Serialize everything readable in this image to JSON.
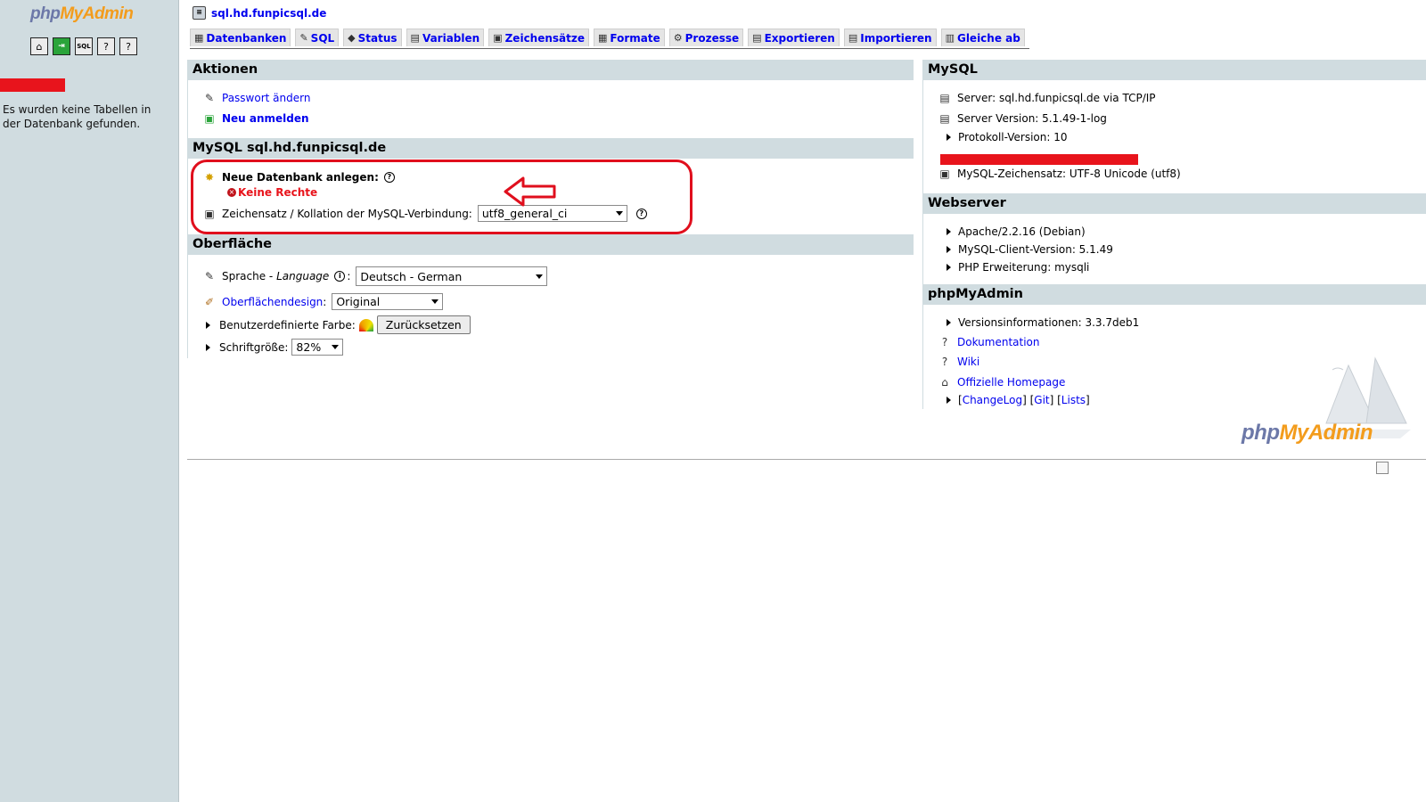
{
  "left": {
    "logo": {
      "php": "php",
      "my": "My",
      "admin": "Admin"
    },
    "icons": [
      "home-icon",
      "exit-icon",
      "sql-icon",
      "docs-icon",
      "docs2-icon"
    ],
    "message": "Es wurden keine Tabellen in der Datenbank gefunden."
  },
  "header": {
    "server": "sql.hd.funpicsql.de"
  },
  "tabs": [
    {
      "label": "Datenbanken",
      "icon": "db-icon"
    },
    {
      "label": "SQL",
      "icon": "sql-icon"
    },
    {
      "label": "Status",
      "icon": "status-icon"
    },
    {
      "label": "Variablen",
      "icon": "variables-icon"
    },
    {
      "label": "Zeichensätze",
      "icon": "charset-icon"
    },
    {
      "label": "Formate",
      "icon": "engines-icon"
    },
    {
      "label": "Prozesse",
      "icon": "processes-icon"
    },
    {
      "label": "Exportieren",
      "icon": "export-icon"
    },
    {
      "label": "Importieren",
      "icon": "import-icon"
    },
    {
      "label": "Gleiche ab",
      "icon": "sync-icon"
    }
  ],
  "aktionen": {
    "title": "Aktionen",
    "change_password": "Passwort ändern",
    "relogin": "Neu anmelden"
  },
  "mysql_server": {
    "title": "MySQL sql.hd.funpicsql.de",
    "create_db_label": "Neue Datenbank anlegen:",
    "no_rights": "Keine Rechte",
    "collation_label": "Zeichensatz / Kollation der MySQL-Verbindung:",
    "collation_value": "utf8_general_ci"
  },
  "oberflaeche": {
    "title": "Oberfläche",
    "language_label": "Sprache - ",
    "language_label_italic": "Language",
    "language_value": "Deutsch - German",
    "theme_label": "Oberflächendesign",
    "theme_value": "Original",
    "custom_color_label": "Benutzerdefinierte Farbe:",
    "reset_button": "Zurücksetzen",
    "font_size_label": "Schriftgröße:",
    "font_size_value": "82%"
  },
  "mysql_info": {
    "title": "MySQL",
    "server": "Server: sql.hd.funpicsql.de via TCP/IP",
    "version": "Server Version: 5.1.49-1-log",
    "protocol": "Protokoll-Version: 10",
    "charset": "MySQL-Zeichensatz: UTF-8 Unicode (utf8)"
  },
  "webserver": {
    "title": "Webserver",
    "apache": "Apache/2.2.16 (Debian)",
    "client": "MySQL-Client-Version: 5.1.49",
    "php_ext": "PHP Erweiterung: mysqli"
  },
  "phpmyadmin": {
    "title": "phpMyAdmin",
    "version": "Versionsinformationen: 3.3.7deb1",
    "docs": "Dokumentation",
    "wiki": "Wiki",
    "homepage": "Offizielle Homepage",
    "changelog": "ChangeLog",
    "git": "Git",
    "lists": "Lists"
  },
  "colors": {
    "accent_red": "#e8141c",
    "panel_head": "#d0dce0",
    "link": "#0000ee"
  }
}
